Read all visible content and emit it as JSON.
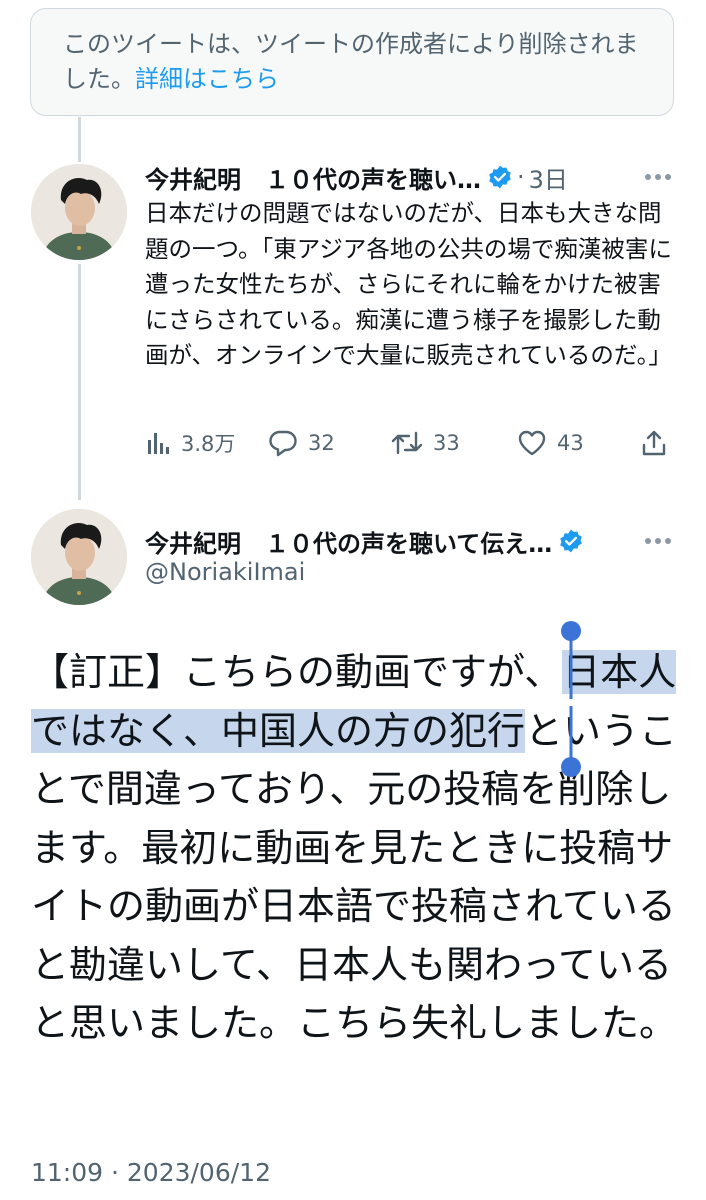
{
  "deleted_notice": {
    "text": "このツイートは、ツイートの作成者により削除されました。",
    "link": "詳細はこちら"
  },
  "quoted_tweet": {
    "author_name": "今井紀明　１０代の声を聴い…",
    "separator": "·",
    "time_ago": "3日",
    "text": "日本だけの問題ではないのだが、日本も大きな問題の一つ。「東アジア各地の公共の場で痴漢被害に遭った女性たちが、さらにそれに輪をかけた被害にさらされている。痴漢に遭う様子を撮影した動画が、オンラインで大量に販売されているのだ。」",
    "views": "3.8万",
    "replies": "32",
    "retweets": "33",
    "likes": "43"
  },
  "main_tweet": {
    "author_name": "今井紀明　１０代の声を聴いて伝え…",
    "handle": "@NoriakiImai",
    "text_before": "【訂正】こちらの動画ですが、",
    "text_selected": "日本人ではなく、中国人の方の犯行",
    "text_after": "ということで間違っており、元の投稿を削除します。最初に動画を見たときに投稿サイトの動画が日本語で投稿されていると勘違いして、日本人も関わっていると思いました。こちら失礼しました。",
    "timestamp": "11:09 · 2023/06/12"
  },
  "colors": {
    "accent": "#1d9bf0",
    "selection": "#c6d6ec",
    "selection_handle": "#3b73d6",
    "secondary_text": "#536471"
  },
  "icons": [
    "verified-badge-icon",
    "more-options-icon",
    "views-icon",
    "reply-icon",
    "retweet-icon",
    "like-icon",
    "share-icon"
  ]
}
